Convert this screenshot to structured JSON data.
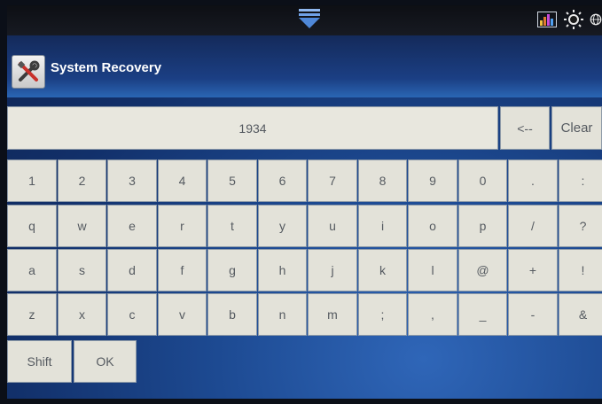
{
  "app": {
    "title": "System Recovery"
  },
  "input": {
    "value": "1934"
  },
  "keys": {
    "backspace": "<--",
    "clear": "Clear",
    "shift": "Shift",
    "ok": "OK",
    "rows": [
      [
        "1",
        "2",
        "3",
        "4",
        "5",
        "6",
        "7",
        "8",
        "9",
        "0",
        ".",
        ":"
      ],
      [
        "q",
        "w",
        "e",
        "r",
        "t",
        "y",
        "u",
        "i",
        "o",
        "p",
        "/",
        "?"
      ],
      [
        "a",
        "s",
        "d",
        "f",
        "g",
        "h",
        "j",
        "k",
        "l",
        "@",
        "+",
        "!"
      ],
      [
        "z",
        "x",
        "c",
        "v",
        "b",
        "n",
        "m",
        ";",
        ",",
        "_",
        "-",
        "&"
      ]
    ]
  },
  "icons": {
    "pull_tab": "chevron-down-icon",
    "signal": "signal-bars-icon",
    "brightness": "brightness-icon",
    "globe": "globe-icon",
    "app": "tools-icon"
  },
  "colors": {
    "key_bg": "#e3e2d9",
    "key_text": "#555a60",
    "accent": "#2a66b4"
  }
}
